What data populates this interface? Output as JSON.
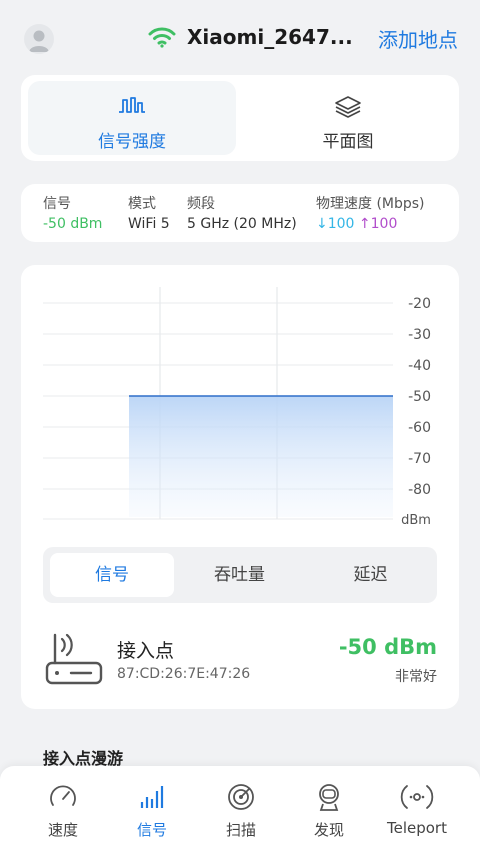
{
  "header": {
    "ssid": "Xiaomi_2647...",
    "add_location": "添加地点"
  },
  "tabs": [
    {
      "label": "信号强度",
      "active": true,
      "icon": "signal-wave-icon"
    },
    {
      "label": "平面图",
      "active": false,
      "icon": "layers-icon"
    }
  ],
  "info": {
    "signal_label": "信号",
    "signal_value": "-50 dBm",
    "mode_label": "模式",
    "mode_value": "WiFi 5",
    "band_label": "频段",
    "band_value": "5 GHz (20 MHz)",
    "speed_label": "物理速度 (Mbps)",
    "speed_down": "↓100",
    "speed_up": "↑100"
  },
  "chart_data": {
    "type": "area",
    "ylabel": "dBm",
    "y_ticks": [
      "-20",
      "-30",
      "-40",
      "-50",
      "-60",
      "-70",
      "-80"
    ],
    "ylim": [
      -90,
      -15
    ],
    "series": [
      {
        "values": [
          -50
        ]
      }
    ],
    "grid": true
  },
  "segments": [
    {
      "label": "信号",
      "active": true
    },
    {
      "label": "吞吐量",
      "active": false
    },
    {
      "label": "延迟",
      "active": false
    }
  ],
  "access_point": {
    "title": "接入点",
    "mac": "87:CD:26:7E:47:26",
    "dbm": "-50 dBm",
    "quality": "非常好"
  },
  "roaming_title": "接入点漫游",
  "bottom_nav": [
    {
      "label": "速度",
      "icon": "speedometer-icon",
      "active": false
    },
    {
      "label": "信号",
      "icon": "signal-bars-icon",
      "active": true
    },
    {
      "label": "扫描",
      "icon": "radar-icon",
      "active": false
    },
    {
      "label": "发现",
      "icon": "discover-icon",
      "active": false
    },
    {
      "label": "Teleport",
      "icon": "teleport-icon",
      "active": false
    }
  ],
  "colors": {
    "accent": "#1f7ae0",
    "good": "#3fbf63",
    "down": "#33b6e6",
    "up": "#b14dcb"
  }
}
